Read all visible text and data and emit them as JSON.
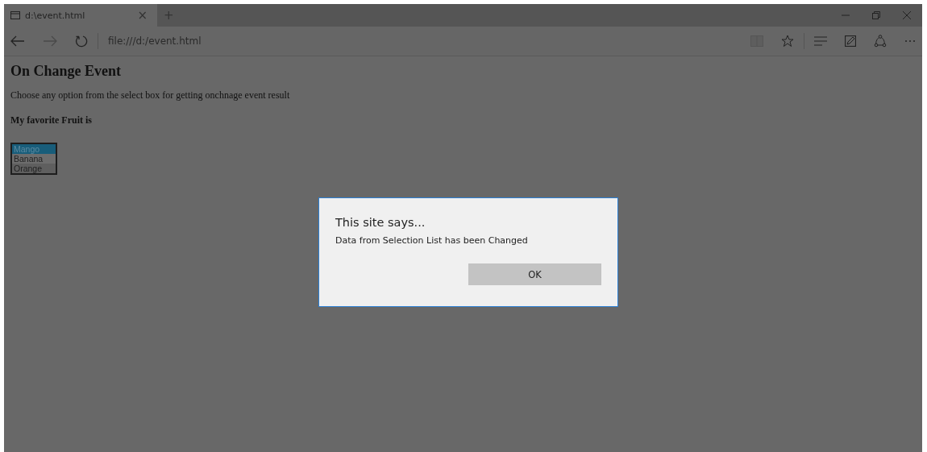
{
  "tab": {
    "title": "d:\\event.html",
    "close": "×",
    "new_tab": "+"
  },
  "address_bar": {
    "value": "file:///d:/event.html"
  },
  "page": {
    "heading": "On Change Event",
    "instruction": "Choose any option from the select box for getting onchnage event result",
    "label": "My favorite Fruit is",
    "options": [
      {
        "label": "Mango",
        "selected": true
      },
      {
        "label": "Banana",
        "selected": false
      },
      {
        "label": "Orange",
        "selected": false
      }
    ]
  },
  "dialog": {
    "title": "This site says...",
    "message": "Data from Selection List has been Changed",
    "button": "OK"
  }
}
